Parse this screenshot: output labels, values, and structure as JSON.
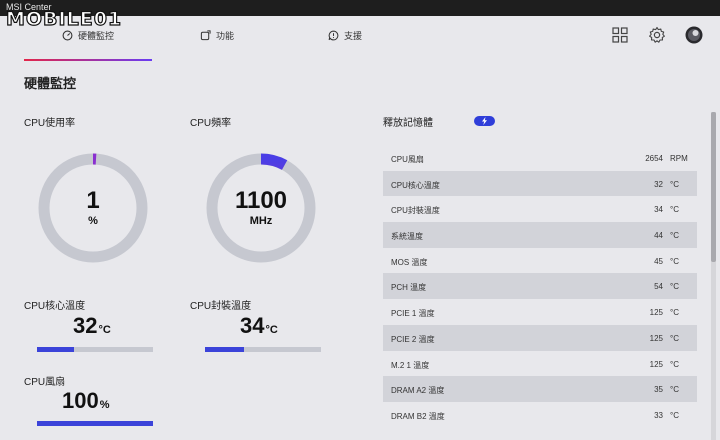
{
  "window": {
    "title": "MSI Center"
  },
  "watermark": {
    "text": "MOBILE01"
  },
  "tabs": [
    {
      "label": "硬體監控",
      "icon": "monitor-icon",
      "active": true
    },
    {
      "label": "功能",
      "icon": "feature-icon"
    },
    {
      "label": "支援",
      "icon": "support-icon"
    }
  ],
  "page_title": "硬體監控",
  "cpu_usage": {
    "label": "CPU使用率",
    "value": "1",
    "unit": "%",
    "fraction": 0.01
  },
  "cpu_freq": {
    "label": "CPU頻率",
    "value": "1100",
    "unit": "MHz",
    "fraction": 0.08
  },
  "cpu_core_temp": {
    "label": "CPU核心溫度",
    "value": "32",
    "unit": "°C",
    "fraction": 0.32
  },
  "cpu_pkg_temp": {
    "label": "CPU封裝溫度",
    "value": "34",
    "unit": "°C",
    "fraction": 0.34
  },
  "cpu_fan": {
    "label": "CPU風扇",
    "value": "100",
    "unit": "%",
    "fraction": 1.0
  },
  "memory": {
    "title": "釋放記憶體",
    "button_icon": "lightning-icon"
  },
  "sensor_rows": [
    {
      "name": "CPU風扇",
      "value": "2654",
      "unit": "RPM"
    },
    {
      "name": "CPU核心溫度",
      "value": "32",
      "unit": "°C"
    },
    {
      "name": "CPU封裝溫度",
      "value": "34",
      "unit": "°C"
    },
    {
      "name": "系統溫度",
      "value": "44",
      "unit": "°C"
    },
    {
      "name": "MOS 溫度",
      "value": "45",
      "unit": "°C"
    },
    {
      "name": "PCH 溫度",
      "value": "54",
      "unit": "°C"
    },
    {
      "name": "PCIE 1 溫度",
      "value": "125",
      "unit": "°C"
    },
    {
      "name": "PCIE 2 溫度",
      "value": "125",
      "unit": "°C"
    },
    {
      "name": "M.2 1 溫度",
      "value": "125",
      "unit": "°C"
    },
    {
      "name": "DRAM A2 溫度",
      "value": "35",
      "unit": "°C"
    },
    {
      "name": "DRAM B2 溫度",
      "value": "33",
      "unit": "°C"
    }
  ],
  "colors": {
    "accent": "#3b43d9",
    "track": "#c6c8d0",
    "gradient_start": "#e2264a",
    "gradient_end": "#6a3cf2"
  }
}
